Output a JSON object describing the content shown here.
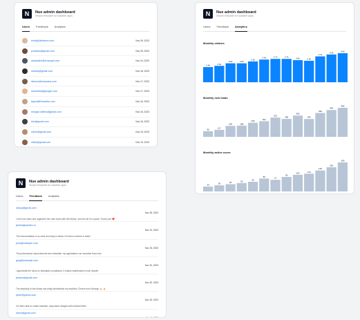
{
  "app": {
    "title": "Nue admin dashboard",
    "subtitle": "Simple template for scalable apps"
  },
  "tabs": {
    "users": "Users",
    "feedback": "Feedback",
    "analytics": "Analytics"
  },
  "colors": {
    "brand_blue": "#0a84ff",
    "muted_bar": "#b7c5d6",
    "link": "#1a6fd6"
  },
  "users": [
    {
      "email": "emily@defiance.com",
      "date": "Nov 26, 2023",
      "avatar_color": "#d9b9a0"
    },
    {
      "email": "jonathan@gmail.com",
      "date": "Nov 25, 2023",
      "avatar_color": "#6f4a3d"
    },
    {
      "email": "askatoshe@example.com",
      "date": "Nov 24, 2023",
      "avatar_color": "#4b5563"
    },
    {
      "email": "sandra@gmail.com",
      "date": "Nov 18, 2023",
      "avatar_color": "#2d2d2d"
    },
    {
      "email": "damon@company.com",
      "date": "Nov 17, 2023",
      "avatar_color": "#7c5c4b"
    },
    {
      "email": "samantha@google.com",
      "date": "Nov 17, 2023",
      "avatar_color": "#e5b38f"
    },
    {
      "email": "taylor@freewebs.com",
      "date": "Nov 16, 2023",
      "avatar_color": "#bfa18f"
    },
    {
      "email": "morgan.wilkins@gmail.com",
      "date": "Nov 16, 2023",
      "avatar_color": "#a47a64"
    },
    {
      "email": "kim@gmail.com",
      "date": "Nov 15, 2023",
      "avatar_color": "#3f3f46"
    },
    {
      "email": "robert@gmail.com",
      "date": "Nov 15, 2023",
      "avatar_color": "#b68b6e"
    },
    {
      "email": "olivia@gmail.com",
      "date": "Nov 15, 2023",
      "avatar_color": "#8b5e4a"
    }
  ],
  "feedback": [
    {
      "email": "nancy@gmail.com",
      "text": "I love how clean and organized the code looks with this library. Just set me for a quick. Thank you! ❤️",
      "date": "Nov 25, 2023"
    },
    {
      "email": "james@yandex.ru",
      "text": "The documentation is so clear and easy to follow. It's been a breeze to learn!",
      "date": "Nov 24, 2023"
    },
    {
      "email": "john@example.com",
      "text": "The performance improvements are noticeable, my applications run smoother than ever",
      "date": "Nov 23, 2023"
    },
    {
      "email": "greg@example.com",
      "text": "I appreciate the focus on standards compliance, it makes maintenance much simpler",
      "date": "Nov 22, 2023"
    },
    {
      "email": "jessica@gmail.com",
      "text": "The simplicity of this library has really streamlined my workflow. Cheers from Norway! 🍺 🍺",
      "date": "Nov 20, 2023"
    },
    {
      "email": "peter@yahoo.com",
      "text": "I've been able to create beautiful, responsive designs with minimal effort",
      "date": "Nov 15, 2023"
    },
    {
      "email": "steve@gmail.com",
      "text": "The community support for this library is fantastic. I",
      "date": "Nov 9, 2023"
    }
  ],
  "analytics": {
    "visitors_label": "Monthly visitors",
    "leads_label": "Monthly new leads",
    "active_label": "Monthly active users"
  },
  "chart_data": [
    {
      "type": "bar",
      "title": "Monthly visitors",
      "values": [
        2.4,
        2.6,
        3.0,
        3.0,
        3.3,
        3.6,
        3.7,
        3.7,
        3.5,
        3.4,
        4.1,
        4.4,
        4.6
      ],
      "value_labels": [
        "2.4k",
        "2.6k",
        "3.0k",
        "3.0k",
        "3.3k",
        "3.6k",
        "3.7k",
        "3.7k",
        "3.5k",
        "3.4k",
        "4.1k",
        "4.4k",
        "4.6k"
      ],
      "color": "#0a84ff"
    },
    {
      "type": "bar",
      "title": "Monthly new leads",
      "values": [
        95,
        117,
        183,
        188,
        236,
        262,
        323,
        300,
        356,
        299,
        399,
        449,
        486
      ],
      "value_labels": [
        "95",
        "117",
        "183",
        "188",
        "236",
        "262",
        "323",
        "300",
        "356",
        "299",
        "399",
        "449",
        "486"
      ],
      "color": "#b7c5d6"
    },
    {
      "type": "bar",
      "title": "Monthly active users",
      "values": [
        30,
        38,
        45,
        52,
        60,
        80,
        72,
        90,
        103,
        110,
        130,
        150,
        180
      ],
      "value_labels": [
        "30",
        "38",
        "45",
        "52",
        "60",
        "80",
        "72",
        "90",
        "103",
        "110",
        "130",
        "150",
        "180"
      ],
      "color": "#b7c5d6"
    }
  ]
}
